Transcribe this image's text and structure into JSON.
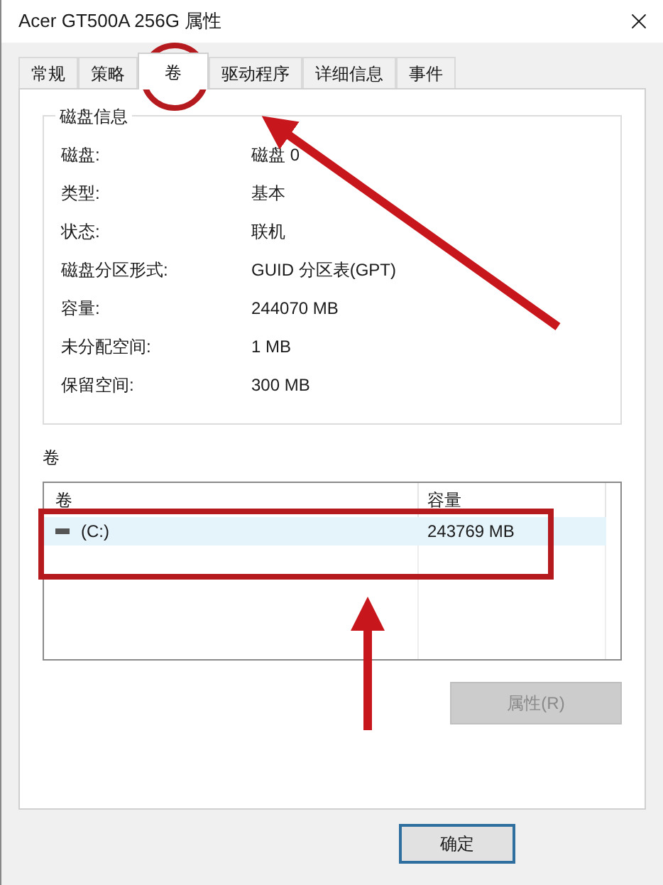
{
  "window": {
    "title": "Acer GT500A 256G 属性"
  },
  "tabs": [
    {
      "label": "常规",
      "selected": false
    },
    {
      "label": "策略",
      "selected": false
    },
    {
      "label": "卷",
      "selected": true
    },
    {
      "label": "驱动程序",
      "selected": false
    },
    {
      "label": "详细信息",
      "selected": false
    },
    {
      "label": "事件",
      "selected": false
    }
  ],
  "disk_info": {
    "title": "磁盘信息",
    "fields": [
      {
        "label": "磁盘:",
        "value": "磁盘 0"
      },
      {
        "label": "类型:",
        "value": "基本"
      },
      {
        "label": "状态:",
        "value": "联机"
      },
      {
        "label": "磁盘分区形式:",
        "value": "GUID 分区表(GPT)"
      },
      {
        "label": "容量:",
        "value": "244070 MB"
      },
      {
        "label": "未分配空间:",
        "value": "1 MB"
      },
      {
        "label": "保留空间:",
        "value": "300 MB"
      }
    ]
  },
  "volumes": {
    "title": "卷",
    "columns": [
      "卷",
      "容量"
    ],
    "rows": [
      {
        "volume": "(C:)",
        "capacity": "243769 MB",
        "selected": true
      }
    ]
  },
  "properties_button": {
    "label": "属性(R)",
    "disabled": true
  },
  "footer_buttons": [
    {
      "label": "确定",
      "default": true
    }
  ]
}
